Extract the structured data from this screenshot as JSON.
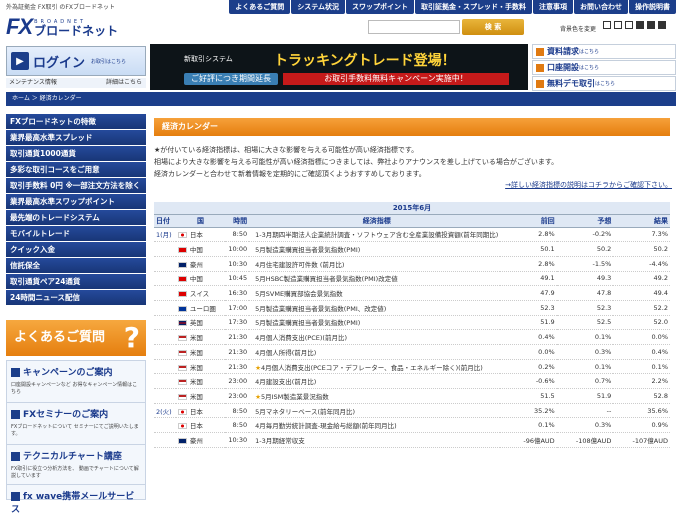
{
  "header": {
    "tagline": "外為証拠金 FX取引 のFXブロードネット",
    "logo_fx": "FX",
    "logo_en": "BROADNET",
    "logo_jp": "ブロードネット",
    "nav": [
      "よくあるご質問",
      "システム状況",
      "スワップポイント",
      "取引証拠金・スプレッド・手数料",
      "注意事項",
      "お問い合わせ",
      "操作説明書"
    ],
    "search_button": "検 索",
    "font_size_label": "背景色を変更"
  },
  "login": {
    "title": "ログイン",
    "sub": "お取引はこちら",
    "maintenance": "メンテナンス情報",
    "maintenance_link": "詳細はこちら"
  },
  "banner": {
    "line1": "新取引システム",
    "line2": "トラッキングトレード登場！",
    "line3": "ご好評につき期間延長",
    "line4": "お取引手数料無料キャンペーン実施中！"
  },
  "right_links": [
    {
      "label": "資料請求",
      "suffix": "はこちら"
    },
    {
      "label": "口座開設",
      "suffix": "はこちら"
    },
    {
      "label": "無料デモ取引",
      "suffix": "はこちら"
    }
  ],
  "breadcrumb": "ホーム ＞ 経済カレンダー",
  "leftnav": [
    "FXブロードネットの特徴",
    "業界最高水準スプレッド",
    "取引通貨1000通貨",
    "多彩な取引コースをご用意",
    "取引手数料 0円 ※一部注文方法を除く",
    "業界最高水準スワップポイント",
    "最先端のトレードシステム",
    "モバイルトレード",
    "クイック入金",
    "信託保全",
    "取引通貨ペア24通貨",
    "24時間ニュース配信"
  ],
  "faq": {
    "label": "よくあるご質問",
    "mark": "?"
  },
  "promos": [
    {
      "title": "キャンペーンのご案内",
      "desc": "口座開設キャンペーンなど お得なキャンペーン情報はこちら"
    },
    {
      "title": "FXセミナーのご案内",
      "desc": "FXブロードネットについて セミナーにてご説明いたします。"
    },
    {
      "title": "テクニカルチャート講座",
      "desc": "FX取引に役立つ分析方法を、 動画でチャートについて解説しています"
    },
    {
      "title": "fx wave携帯メールサービス",
      "desc": ""
    }
  ],
  "main": {
    "title": "経済カレンダー",
    "intro1": "★が付いている経済指標は、相場に大きな影響を与える可能性が高い経済指標です。",
    "intro2": "相場により大きな影響を与える可能性が高い経済指標につきましては、弊社よりアナウンスを差し上げている場合がございます。",
    "intro3": "経済カレンダーと合わせて新着情報を定期的にご確認頂くようおすすめしております。",
    "detail_link": "→詳しい経済指標の説明はコチラからご確認下さい。",
    "month": "2015年6月",
    "columns": [
      "日付",
      "国",
      "時間",
      "経済指標",
      "前回",
      "予想",
      "結果"
    ],
    "rows": [
      {
        "day": "1(月)",
        "flag": "jp",
        "country": "日本",
        "time": "8:50",
        "star": "",
        "indicator": "1-3月期四半期法人企業統計調査・ソフトウェア含む全産業設備投資額(前年同期比)",
        "prev": "2.8%",
        "fc": "-0.2%",
        "res": "7.3%"
      },
      {
        "day": "",
        "flag": "cn",
        "country": "中国",
        "time": "10:00",
        "star": "",
        "indicator": "5月製造業購買担当者景気指数(PMI)",
        "prev": "50.1",
        "fc": "50.2",
        "res": "50.2"
      },
      {
        "day": "",
        "flag": "au",
        "country": "豪州",
        "time": "10:30",
        "star": "",
        "indicator": "4月住宅建設許可件数 (前月比)",
        "prev": "2.8%",
        "fc": "-1.5%",
        "res": "-4.4%"
      },
      {
        "day": "",
        "flag": "cn",
        "country": "中国",
        "time": "10:45",
        "star": "",
        "indicator": "5月HSBC製造業購買担当者景気指数(PMI)改定値",
        "prev": "49.1",
        "fc": "49.3",
        "res": "49.2"
      },
      {
        "day": "",
        "flag": "ch",
        "country": "スイス",
        "time": "16:30",
        "star": "",
        "indicator": "5月SVME購買部協会景気指数",
        "prev": "47.9",
        "fc": "47.8",
        "res": "49.4"
      },
      {
        "day": "",
        "flag": "eu",
        "country": "ユーロ圏",
        "time": "17:00",
        "star": "",
        "indicator": "5月製造業購買担当者景気指数(PMI、改定値)",
        "prev": "52.3",
        "fc": "52.3",
        "res": "52.2"
      },
      {
        "day": "",
        "flag": "uk",
        "country": "英国",
        "time": "17:30",
        "star": "",
        "indicator": "5月製造業購買担当者景気指数(PMI)",
        "prev": "51.9",
        "fc": "52.5",
        "res": "52.0"
      },
      {
        "day": "",
        "flag": "us",
        "country": "米国",
        "time": "21:30",
        "star": "",
        "indicator": "4月個人消費支出(PCE)(前月比)",
        "prev": "0.4%",
        "fc": "0.1%",
        "res": "0.0%"
      },
      {
        "day": "",
        "flag": "us",
        "country": "米国",
        "time": "21:30",
        "star": "",
        "indicator": "4月個人所得(前月比)",
        "prev": "0.0%",
        "fc": "0.3%",
        "res": "0.4%"
      },
      {
        "day": "",
        "flag": "us",
        "country": "米国",
        "time": "21:30",
        "star": "★",
        "indicator": "4月個人消費支出(PCEコア・デフレーター、食品・エネルギー除く)(前月比)",
        "prev": "0.2%",
        "fc": "0.1%",
        "res": "0.1%"
      },
      {
        "day": "",
        "flag": "us",
        "country": "米国",
        "time": "23:00",
        "star": "",
        "indicator": "4月建設支出(前月比)",
        "prev": "-0.6%",
        "fc": "0.7%",
        "res": "2.2%"
      },
      {
        "day": "",
        "flag": "us",
        "country": "米国",
        "time": "23:00",
        "star": "★",
        "indicator": "5月ISM製造業景況指数",
        "prev": "51.5",
        "fc": "51.9",
        "res": "52.8"
      },
      {
        "day": "2(火)",
        "flag": "jp",
        "country": "日本",
        "time": "8:50",
        "star": "",
        "indicator": "5月マネタリーベース(前年同月比)",
        "prev": "35.2%",
        "fc": "--",
        "res": "35.6%"
      },
      {
        "day": "",
        "flag": "jp",
        "country": "日本",
        "time": "8:50",
        "star": "",
        "indicator": "4月毎月勤労統計調査-現金給与総額(前年同月比)",
        "prev": "0.1%",
        "fc": "0.3%",
        "res": "0.9%"
      },
      {
        "day": "",
        "flag": "au",
        "country": "豪州",
        "time": "10:30",
        "star": "",
        "indicator": "1-3月期経常収支",
        "prev": "-96億AUD",
        "fc": "-108億AUD",
        "res": "-107億AUD"
      }
    ]
  }
}
